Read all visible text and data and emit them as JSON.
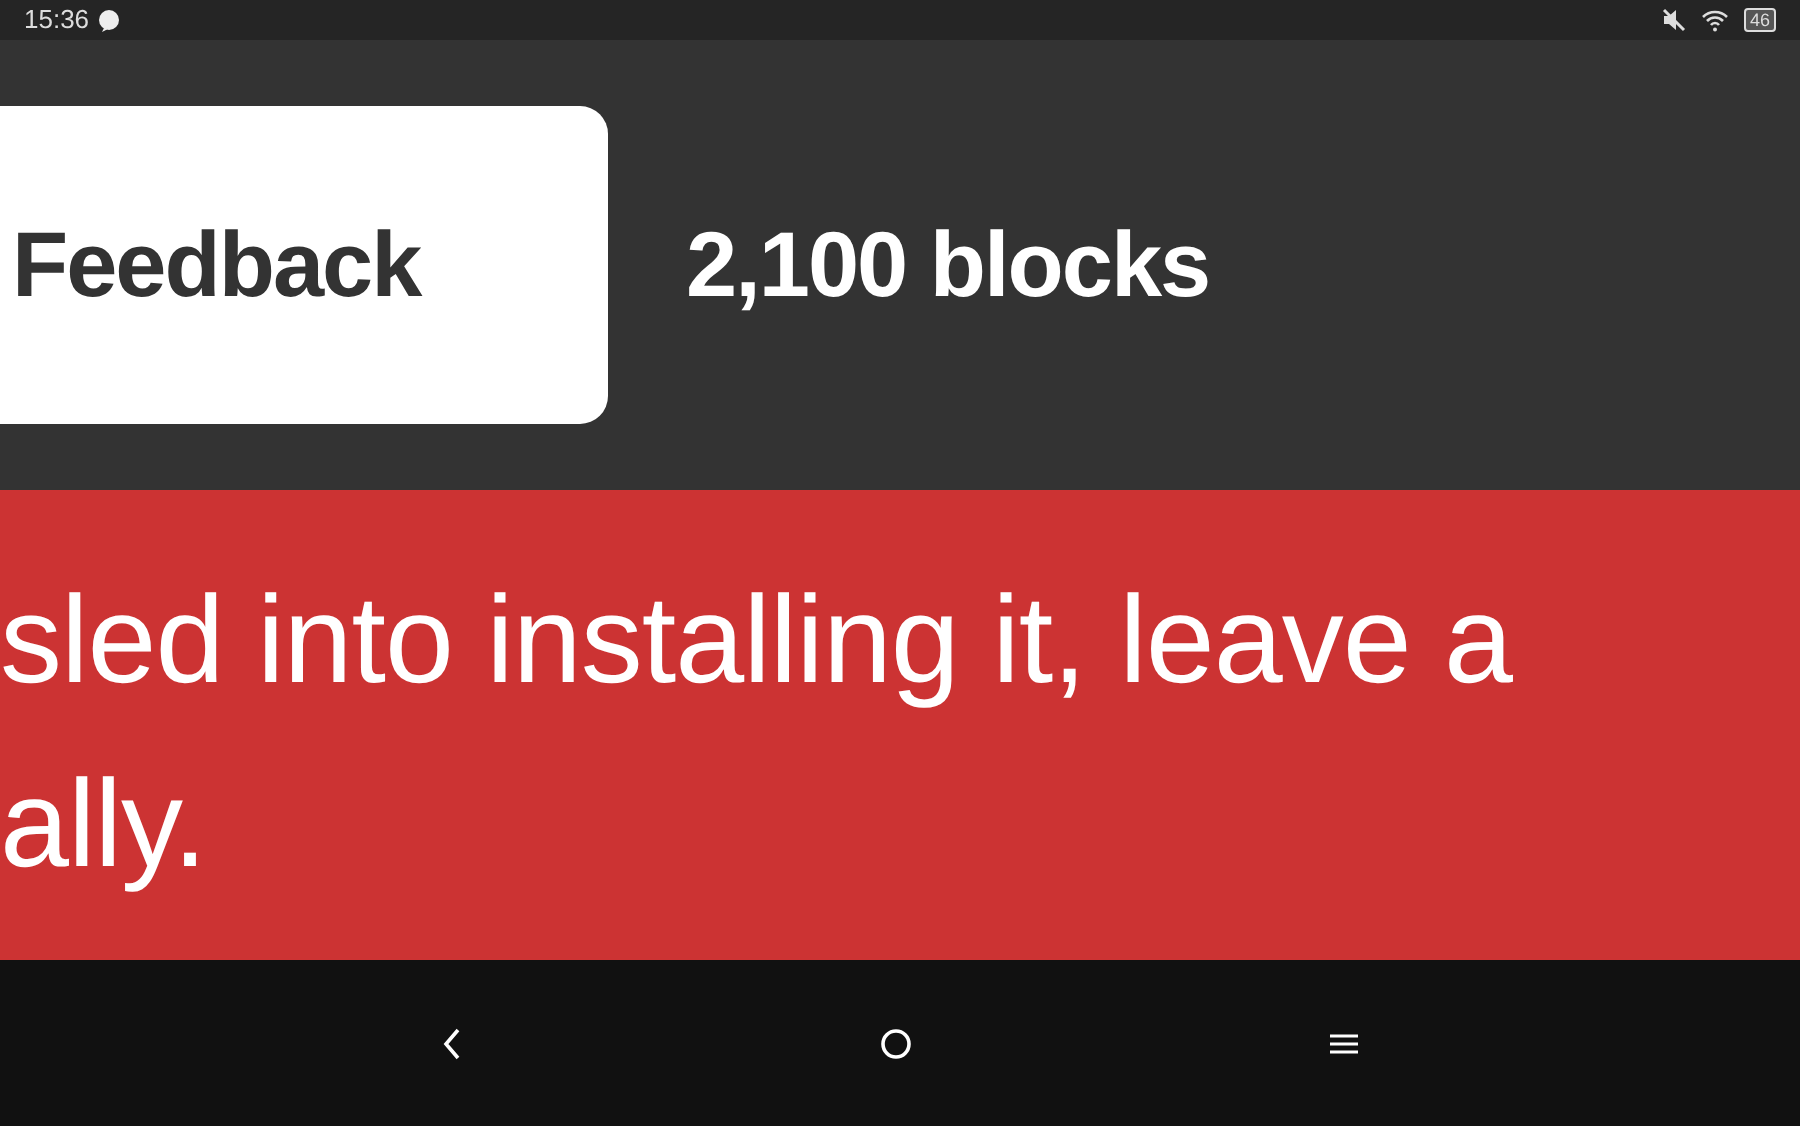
{
  "status_bar": {
    "time": "15:36",
    "battery": "46"
  },
  "header": {
    "button": "Feedback",
    "count": "2,100 blocks"
  },
  "banner": {
    "lines": [
      "sled into installing it, leave a",
      "ally."
    ]
  }
}
